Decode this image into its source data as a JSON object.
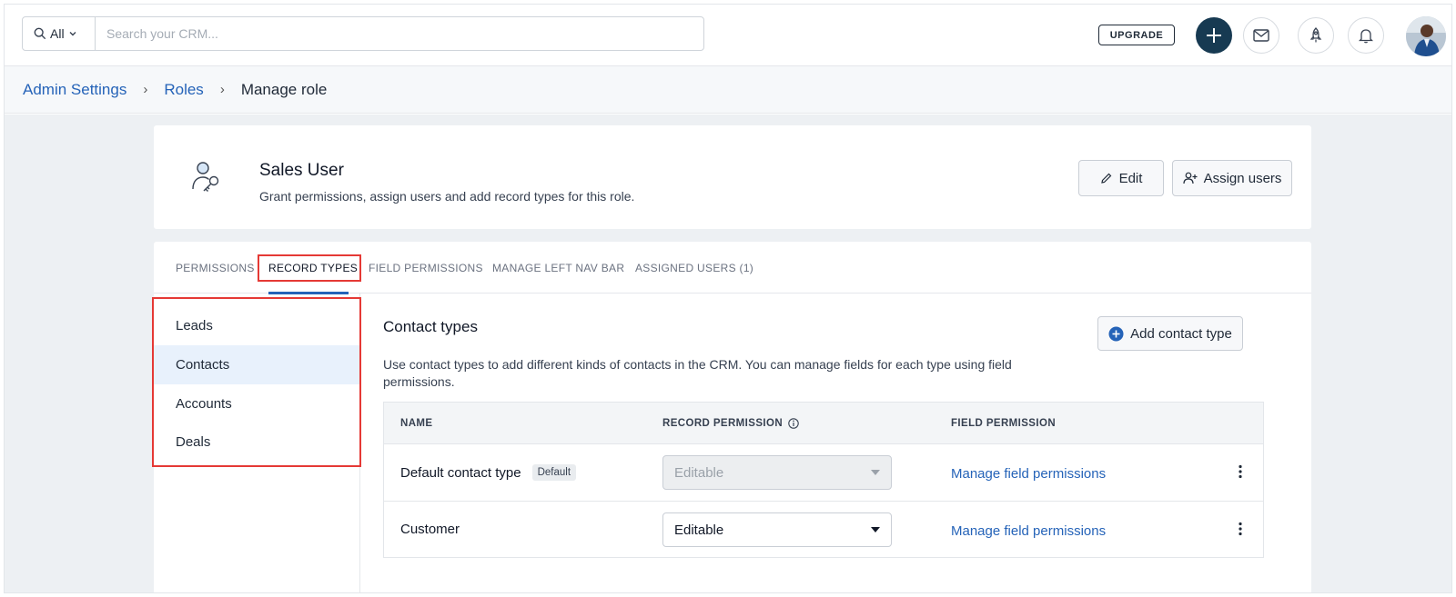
{
  "topbar": {
    "search_scope": "All",
    "search_placeholder": "Search your CRM...",
    "upgrade_label": "UPGRADE"
  },
  "breadcrumb": {
    "items": [
      "Admin Settings",
      "Roles"
    ],
    "current": "Manage role"
  },
  "role": {
    "title": "Sales User",
    "subtitle": "Grant permissions, assign users and add record types for this role.",
    "edit_label": "Edit",
    "assign_label": "Assign users"
  },
  "tabs": [
    {
      "label": "PERMISSIONS"
    },
    {
      "label": "RECORD TYPES"
    },
    {
      "label": "FIELD PERMISSIONS"
    },
    {
      "label": "MANAGE LEFT NAV BAR"
    },
    {
      "label": "ASSIGNED USERS (1)"
    }
  ],
  "sidebar": {
    "items": [
      {
        "label": "Leads"
      },
      {
        "label": "Contacts"
      },
      {
        "label": "Accounts"
      },
      {
        "label": "Deals"
      }
    ]
  },
  "content": {
    "title": "Contact types",
    "add_label": "Add contact type",
    "description": "Use contact types to add different kinds of contacts in the CRM. You can manage fields for each type using field permissions.",
    "columns": [
      "NAME",
      "RECORD PERMISSION",
      "FIELD PERMISSION"
    ],
    "rows": [
      {
        "name": "Default contact type",
        "badge": "Default",
        "permission": "Editable",
        "link": "Manage field permissions"
      },
      {
        "name": "Customer",
        "permission": "Editable",
        "link": "Manage field permissions"
      }
    ]
  },
  "colors": {
    "accent": "#2563b8",
    "highlight": "#e53935",
    "primary_dark": "#173a52"
  }
}
